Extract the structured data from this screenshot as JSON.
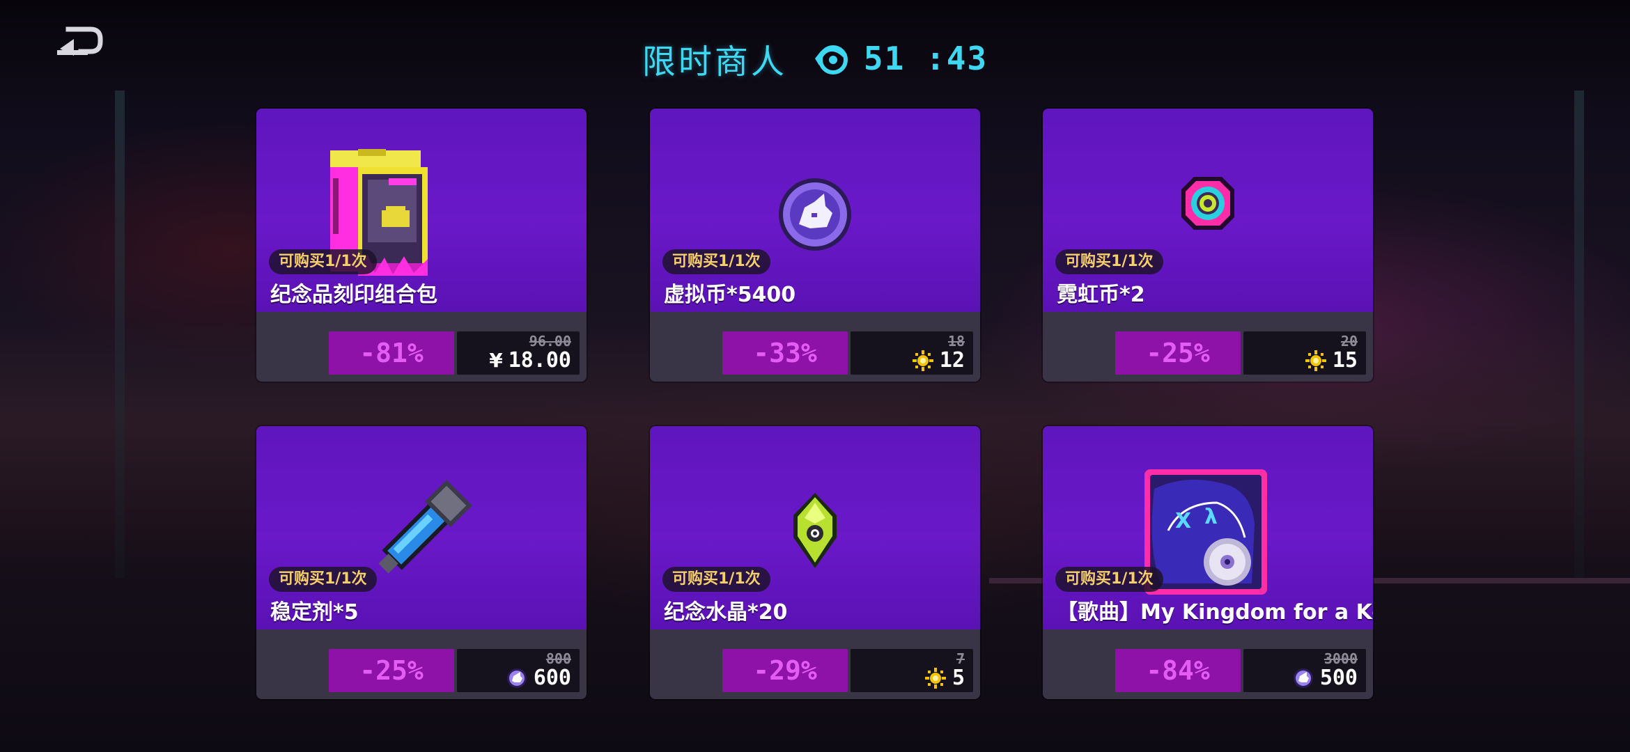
{
  "header": {
    "title": "限时商人",
    "timer": "51 :43",
    "timer_icon": "eye-timer-icon",
    "back_icon": "back-arrow-icon"
  },
  "colors": {
    "accent_cyan": "#3fd8f2",
    "card_purple": "#5f16bd",
    "discount_magenta": "#e35df2",
    "badge_gold": "#f5d06a"
  },
  "items": [
    {
      "badge": "可购买1/1次",
      "name": "纪念品刻印组合包",
      "discount": "-81%",
      "old_price": "96.00",
      "price": "18.00",
      "currency_symbol": "¥",
      "currency": "rmb",
      "icon": "neon-box-pack-icon"
    },
    {
      "badge": "可购买1/1次",
      "name": "虚拟币*5400",
      "discount": "-33%",
      "old_price": "18",
      "price": "12",
      "currency": "gem",
      "icon": "virtual-coin-icon"
    },
    {
      "badge": "可购买1/1次",
      "name": "霓虹币*2",
      "discount": "-25%",
      "old_price": "20",
      "price": "15",
      "currency": "gem",
      "icon": "neon-coin-icon"
    },
    {
      "badge": "可购买1/1次",
      "name": "稳定剂*5",
      "discount": "-25%",
      "old_price": "800",
      "price": "600",
      "currency": "coin",
      "icon": "stabilizer-icon"
    },
    {
      "badge": "可购买1/1次",
      "name": "纪念水晶*20",
      "discount": "-29%",
      "old_price": "7",
      "price": "5",
      "currency": "gem",
      "icon": "memorial-crystal-icon"
    },
    {
      "badge": "可购买1/1次",
      "name": "【歌曲】My Kingdom for a Key",
      "discount": "-84%",
      "old_price": "3000",
      "price": "500",
      "currency": "coin",
      "icon": "song-disc-icon"
    }
  ]
}
